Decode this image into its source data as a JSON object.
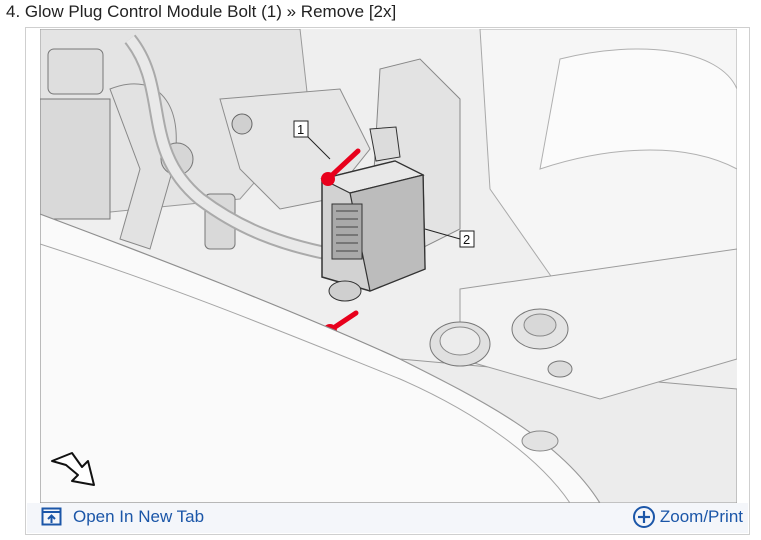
{
  "step": {
    "title": "4. Glow Plug Control Module Bolt (1) » Remove [2x]"
  },
  "figure": {
    "callouts": [
      "1",
      "2"
    ],
    "arrow_icon": "direction-arrow-icon"
  },
  "toolbar": {
    "open_label": "Open In New Tab",
    "open_icon": "open-new-tab-icon",
    "zoom_label": "Zoom/Print",
    "zoom_icon": "zoom-plus-icon",
    "link_color": "#1b56a8",
    "bolt_color": "#e8001c"
  }
}
